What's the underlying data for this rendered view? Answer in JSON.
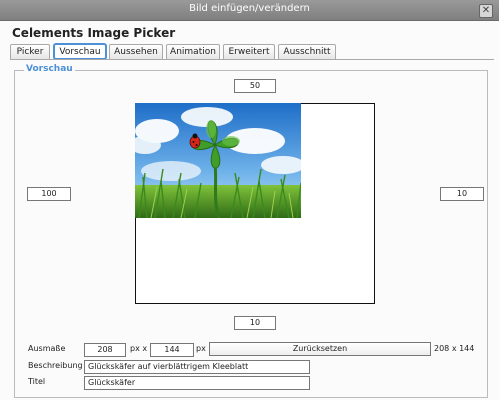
{
  "window": {
    "title": "Bild einfügen/verändern",
    "close_label": "✕"
  },
  "dialog": {
    "heading": "Celements Image Picker"
  },
  "tabs": [
    {
      "label": "Picker"
    },
    {
      "label": "Vorschau"
    },
    {
      "label": "Aussehen"
    },
    {
      "label": "Animation"
    },
    {
      "label": "Erweitert"
    },
    {
      "label": "Ausschnitt"
    }
  ],
  "preview": {
    "legend": "Vorschau",
    "margin_top": "50",
    "margin_left": "100",
    "margin_right": "10",
    "margin_bottom": "10"
  },
  "dimensions": {
    "label": "Ausmaße",
    "width": "208",
    "unit1": "px x",
    "height": "144",
    "unit2": "px",
    "reset_label": "Zurücksetzen",
    "original": "208 x 144"
  },
  "description": {
    "label": "Beschreibung",
    "value": "Glückskäfer auf vierblättrigem Kleeblatt"
  },
  "title_field": {
    "label": "Titel",
    "value": "Glückskäfer"
  },
  "colors": {
    "accent": "#4d90d6",
    "titlebar": "#8c8c8c"
  }
}
